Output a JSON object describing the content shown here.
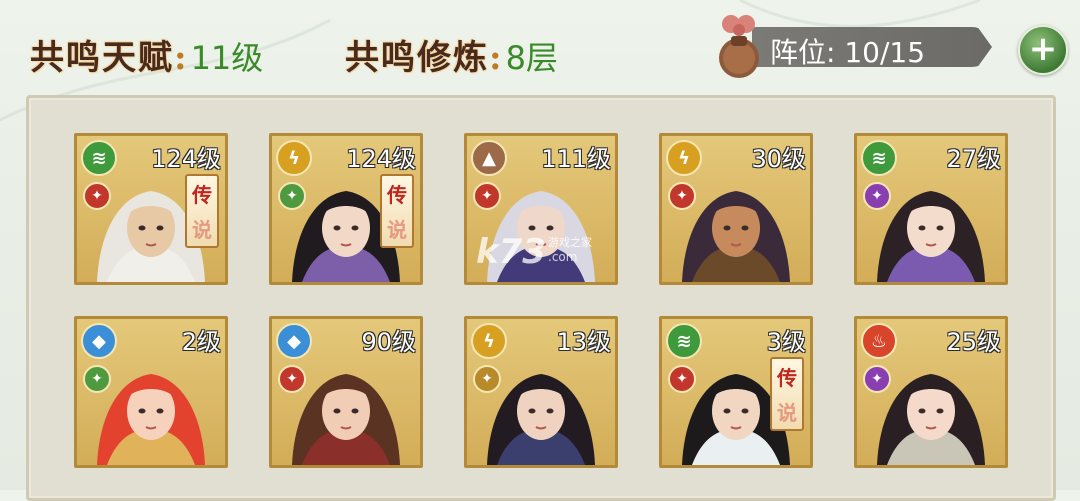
{
  "header": {
    "talent_label": "共鸣天赋",
    "talent_value": "11级",
    "training_label": "共鸣修炼",
    "training_value": "8层",
    "colon": ":",
    "formation_text": "阵位: 10/15",
    "add_symbol": "+"
  },
  "colors": {
    "label_dark": "#4a2a1c",
    "value_green": "#3a8a2a",
    "card_gold": "#d3ad58",
    "wind": "#3f9a3c",
    "thunder": "#d8a020",
    "earth": "#9c6a48",
    "water": "#3b8fd6",
    "fire": "#d8452a",
    "red_sub": "#c1372b",
    "purple_sub": "#8a3fb0",
    "gold_sub": "#b88a2a",
    "green_sub": "#4f9a3e"
  },
  "heroes": [
    {
      "level": "124级",
      "element": "wind-icon",
      "sub": "red",
      "legendary": true,
      "hair": "#e9e6df",
      "skin": "#e8c9a6",
      "robe": "#f1efe9"
    },
    {
      "level": "124级",
      "element": "thunder-icon",
      "sub": "green",
      "legendary": true,
      "hair": "#1f1b1e",
      "skin": "#f2d8c6",
      "robe": "#7d5ea8"
    },
    {
      "level": "111级",
      "element": "earth-icon",
      "sub": "red",
      "legendary": false,
      "hair": "#d9d8e2",
      "skin": "#efd7c9",
      "robe": "#433a7a"
    },
    {
      "level": "30级",
      "element": "thunder-icon",
      "sub": "red",
      "legendary": false,
      "hair": "#3b2a3a",
      "skin": "#c68a5c",
      "robe": "#6b4a2a"
    },
    {
      "level": "27级",
      "element": "wind-icon",
      "sub": "purple",
      "legendary": false,
      "hair": "#2c2226",
      "skin": "#f4dccd",
      "robe": "#7a5bb0"
    },
    {
      "level": "2级",
      "element": "water-icon",
      "sub": "green",
      "legendary": false,
      "hair": "#e3432e",
      "skin": "#f6d2bd",
      "robe": "#e0b25a"
    },
    {
      "level": "90级",
      "element": "water-icon",
      "sub": "red",
      "legendary": false,
      "hair": "#5a3322",
      "skin": "#f0cdb4",
      "robe": "#8a2f2a"
    },
    {
      "level": "13级",
      "element": "thunder-icon",
      "sub": "gold",
      "legendary": false,
      "hair": "#231b22",
      "skin": "#efd3c0",
      "robe": "#3a3f6e"
    },
    {
      "level": "3级",
      "element": "wind-icon",
      "sub": "red",
      "legendary": true,
      "hair": "#1d1a1c",
      "skin": "#f1d6c2",
      "robe": "#eaf0f2"
    },
    {
      "level": "25级",
      "element": "fire-icon",
      "sub": "purple",
      "legendary": false,
      "hair": "#2a2024",
      "skin": "#f5dacb",
      "robe": "#c9c6b8"
    }
  ],
  "legend_tag": {
    "top": "传",
    "bottom": "说"
  },
  "watermark": {
    "logo": "k73",
    "site": "游戏之家",
    "url": ".com"
  }
}
